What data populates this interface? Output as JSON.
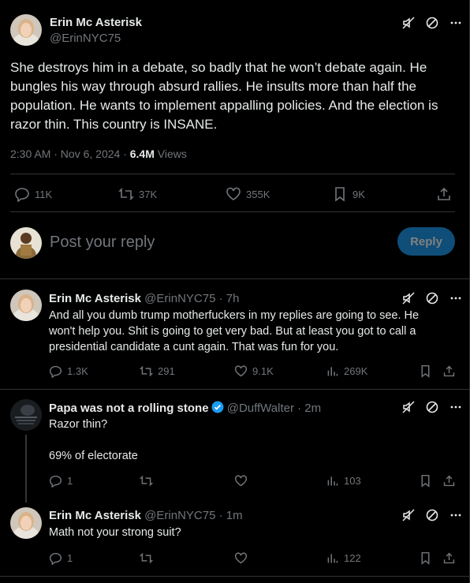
{
  "main_post": {
    "author_name": "Erin Mc Asterisk",
    "author_handle": "@ErinNYC75",
    "text": "She destroys him in a debate, so badly that he won’t debate again. He bungles his way through absurd rallies. He insults more than half the population.  He wants to implement appalling policies.   And the election is razor thin. This country is INSANE.",
    "timestamp": "2:30 AM · Nov 6, 2024 ·",
    "views_count": "6.4M",
    "views_label": "Views",
    "replies": "11K",
    "reposts": "37K",
    "likes": "355K",
    "bookmarks": "9K"
  },
  "composer": {
    "placeholder": "Post your reply",
    "button_label": "Reply"
  },
  "replies": [
    {
      "author_name": "Erin Mc Asterisk",
      "author_handle": "@ErinNYC75",
      "time": "· 7h",
      "text": "And all you dumb trump motherfuckers in my replies are going to see.  He won't help you. Shit is going to get very bad. But at least you got to call a presidential candidate a cunt again. That was fun for you.",
      "replies": "1.3K",
      "reposts": "291",
      "likes": "9.1K",
      "views": "269K"
    },
    {
      "author_name": "Papa was not a rolling stone",
      "author_handle": "@DuffWalter",
      "time": "· 2m",
      "text_line1": "Razor thin?",
      "text_line2": "69% of electorate",
      "replies": "1",
      "reposts": "",
      "likes": "",
      "views": "103"
    },
    {
      "author_name": "Erin Mc Asterisk",
      "author_handle": "@ErinNYC75",
      "time": "· 1m",
      "text": "Math not your strong suit?",
      "replies": "1",
      "reposts": "",
      "likes": "",
      "views": "122"
    }
  ],
  "colors": {
    "accent": "#1d9bf0",
    "text": "#e7e9ea",
    "muted": "#71767b",
    "border": "#2f3336"
  }
}
